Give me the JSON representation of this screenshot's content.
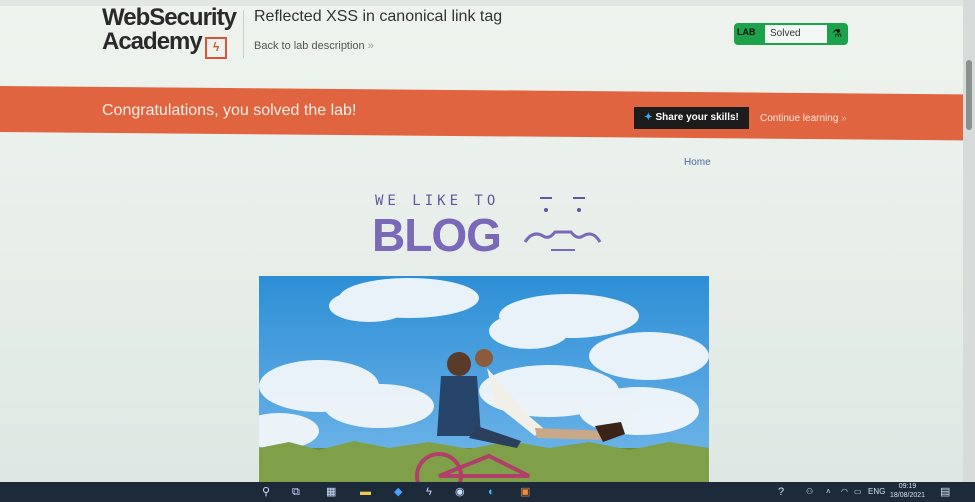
{
  "header": {
    "logo_line1": "WebSecurity",
    "logo_line2": "Academy",
    "lab_title": "Reflected XSS in canonical link tag",
    "back_link": "Back to lab description",
    "status_tag": "LAB",
    "status_value": "Solved"
  },
  "banner": {
    "message": "Congratulations, you solved the lab!",
    "share_label": "Share your skills!",
    "continue_label": "Continue learning"
  },
  "nav": {
    "home": "Home"
  },
  "blog": {
    "subtitle": "WE LIKE TO",
    "title": "BLOG"
  },
  "taskbar": {
    "language": "ENG",
    "time": "09:19",
    "date": "18/08/2021"
  },
  "colors": {
    "banner": "#e0643f",
    "status_green": "#1ba24a",
    "blog_purple": "#7a68b8"
  }
}
